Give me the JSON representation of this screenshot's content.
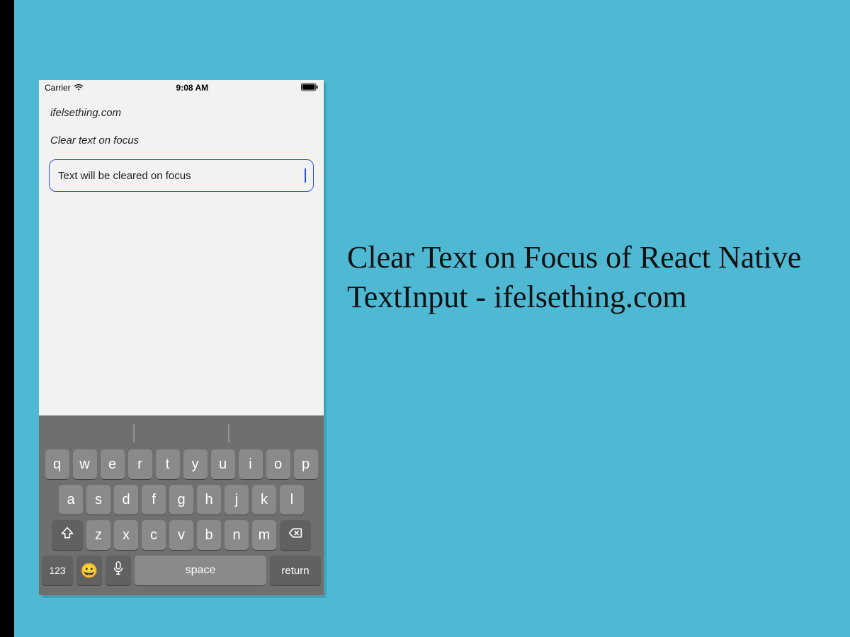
{
  "status_bar": {
    "carrier": "Carrier",
    "time": "9:08 AM"
  },
  "app": {
    "site_label": "ifelsething.com",
    "subtitle": "Clear text on focus",
    "input_value": "Text will be cleared on focus"
  },
  "keyboard": {
    "row1": [
      "q",
      "w",
      "e",
      "r",
      "t",
      "y",
      "u",
      "i",
      "o",
      "p"
    ],
    "row2": [
      "a",
      "s",
      "d",
      "f",
      "g",
      "h",
      "j",
      "k",
      "l"
    ],
    "row3": [
      "z",
      "x",
      "c",
      "v",
      "b",
      "n",
      "m"
    ],
    "numbers_label": "123",
    "space_label": "space",
    "return_label": "return",
    "emoji_glyph": "😀"
  },
  "headline": "Clear Text on Focus of React Native TextInput - ifelsething.com"
}
